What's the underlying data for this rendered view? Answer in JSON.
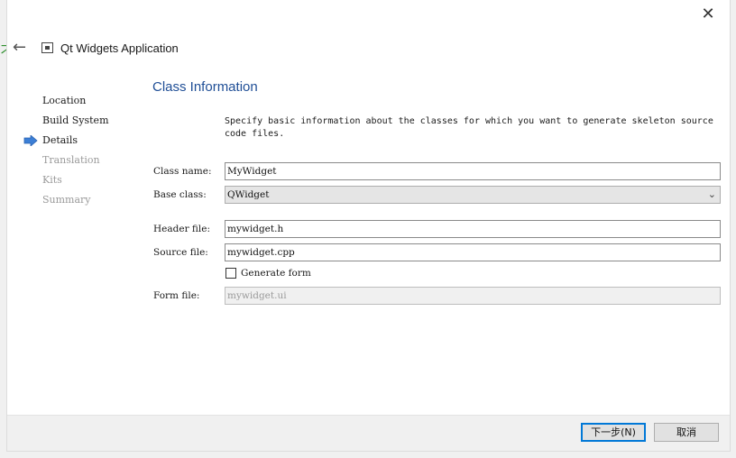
{
  "window": {
    "title": "Qt Widgets Application",
    "close_glyph": "✕",
    "back_glyph": "←",
    "side_glyph": "刁"
  },
  "steps": [
    {
      "label": "Location",
      "state": "done"
    },
    {
      "label": "Build System",
      "state": "done"
    },
    {
      "label": "Details",
      "state": "current"
    },
    {
      "label": "Translation",
      "state": "pending"
    },
    {
      "label": "Kits",
      "state": "pending"
    },
    {
      "label": "Summary",
      "state": "pending"
    }
  ],
  "page": {
    "title": "Class Information",
    "description": "Specify basic information about the classes for which you want to generate skeleton source code files."
  },
  "form": {
    "class_name_label": "Class name:",
    "class_name_value": "MyWidget",
    "base_class_label": "Base class:",
    "base_class_value": "QWidget",
    "header_file_label": "Header file:",
    "header_file_value": "mywidget.h",
    "source_file_label": "Source file:",
    "source_file_value": "mywidget.cpp",
    "generate_form_label": "Generate form",
    "generate_form_checked": false,
    "form_file_label": "Form file:",
    "form_file_value": "mywidget.ui"
  },
  "buttons": {
    "next_label": "下一步(N)",
    "cancel_label": "取消"
  },
  "colors": {
    "accent": "#1f4e96",
    "step_arrow": "#3c7fd6",
    "primary_border": "#0078d7"
  },
  "icons": {
    "current_step": "arrow-right-icon",
    "back": "back-arrow-icon",
    "close": "close-icon",
    "combo": "chevron-down-icon"
  }
}
